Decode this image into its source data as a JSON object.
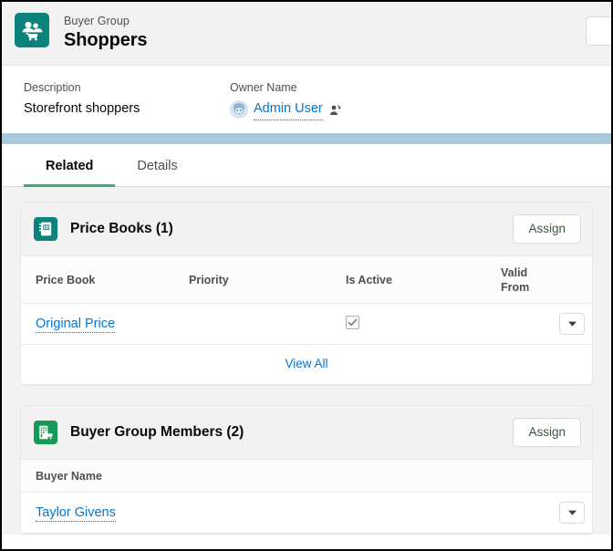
{
  "record_header": {
    "entity_icon": "buyer-group-icon",
    "eyebrow": "Buyer Group",
    "title": "Shoppers",
    "corner_button": ""
  },
  "highlights": [
    {
      "label": "Description",
      "value": "Storefront shoppers",
      "type": "text"
    },
    {
      "label": "Owner Name",
      "value": "Admin User",
      "type": "link",
      "avatar_icon": "astro-avatar-icon",
      "trailing_icon": "change-owner-icon"
    }
  ],
  "tabs": [
    {
      "label": "Related",
      "active": true
    },
    {
      "label": "Details",
      "active": false
    }
  ],
  "cards": [
    {
      "icon": "price-book-icon",
      "icon_color": "#0b827c",
      "title": "Price Books (1)",
      "action_label": "Assign",
      "columns": [
        "Price Book",
        "Priority",
        "Is Active",
        "Valid From"
      ],
      "rows": [
        {
          "name": "Original Price",
          "priority": "",
          "is_active": true,
          "valid_from": "",
          "row_action_icon": "chevron-down-icon"
        }
      ],
      "footer_link": "View All"
    },
    {
      "icon": "buyer-group-member-icon",
      "icon_color": "#169b57",
      "title": "Buyer Group Members (2)",
      "action_label": "Assign",
      "columns": [
        "Buyer Name"
      ],
      "rows": [
        {
          "name": "Taylor Givens",
          "row_action_icon": "chevron-down-icon"
        }
      ],
      "footer_link": ""
    }
  ],
  "colors": {
    "brand_teal": "#0b827c",
    "brand_green": "#169b57",
    "link_blue": "#0176d3",
    "tab_underline": "#5a9b7d",
    "band_blue": "#a9cada",
    "page_gray": "#f3f2f2"
  }
}
